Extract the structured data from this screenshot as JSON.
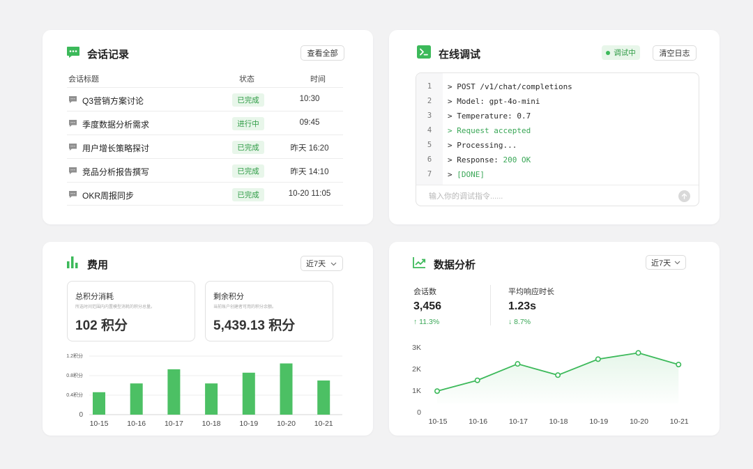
{
  "colors": {
    "accent": "#3cb95a",
    "accent_light": "#e8f6ea",
    "muted": "#999999"
  },
  "sessions": {
    "title": "会话记录",
    "icon": "chat-bubble-icon",
    "view_all": "查看全部",
    "headers": {
      "title": "会话标题",
      "status": "状态",
      "time": "时间"
    },
    "rows": [
      {
        "title": "Q3营销方案讨论",
        "status": "已完成",
        "time": "10:30"
      },
      {
        "title": "季度数据分析需求",
        "status": "进行中",
        "time": "09:45"
      },
      {
        "title": "用户增长策略探讨",
        "status": "已完成",
        "time": "昨天 16:20"
      },
      {
        "title": "竞品分析报告撰写",
        "status": "已完成",
        "time": "昨天 14:10"
      },
      {
        "title": "OKR周报同步",
        "status": "已完成",
        "time": "10-20 11:05"
      }
    ]
  },
  "debug": {
    "title": "在线调试",
    "icon": "terminal-icon",
    "status": "调试中",
    "clear": "清空日志",
    "lines": [
      {
        "num": "1",
        "text": "> POST /v1/chat/completions"
      },
      {
        "num": "2",
        "text": "> Model: gpt-4o-mini"
      },
      {
        "num": "3",
        "text": "> Temperature: 0.7"
      },
      {
        "num": "4",
        "text": "> Request accepted"
      },
      {
        "num": "5",
        "text": "> Processing..."
      },
      {
        "num": "6",
        "prefix": "> Response: ",
        "highlight": "200 OK"
      },
      {
        "num": "7",
        "prefix": "> ",
        "highlight": "[DONE]"
      }
    ],
    "input_placeholder": "输入你的调试指令......"
  },
  "cost": {
    "title": "费用",
    "icon": "bar-chart-icon",
    "range": "近7天",
    "total": {
      "label": "总积分消耗",
      "desc": "所选时间范围内内置模型消耗的积分总量。",
      "value": "102 积分"
    },
    "remaining": {
      "label": "剩余积分",
      "desc": "当前账户创建者可用的积分余额。",
      "value": "5,439.13 积分"
    }
  },
  "analytics": {
    "title": "数据分析",
    "icon": "trend-chart-icon",
    "range": "近7天",
    "sessions_label": "会话数",
    "sessions_value": "3,456",
    "sessions_change": "↑ 11.3%",
    "latency_label": "平均响应时长",
    "latency_value": "1.23s",
    "latency_change": "↓ 8.7%"
  },
  "chart_data": [
    {
      "type": "bar",
      "categories": [
        "10-15",
        "10-16",
        "10-17",
        "10-18",
        "10-19",
        "10-20",
        "10-21"
      ],
      "values": [
        0.46,
        0.64,
        0.93,
        0.64,
        0.86,
        1.05,
        0.7
      ],
      "yticks": [
        "0",
        "0.4积分",
        "0.8积分",
        "1.2积分"
      ],
      "ylim": [
        0,
        1.2
      ],
      "grid": true
    },
    {
      "type": "area",
      "categories": [
        "10-15",
        "10-16",
        "10-17",
        "10-18",
        "10-19",
        "10-20",
        "10-21"
      ],
      "values": [
        960,
        1460,
        2220,
        1700,
        2440,
        2730,
        2190
      ],
      "yticks": [
        "0",
        "1K",
        "2K",
        "3K"
      ],
      "ylim": [
        0,
        3000
      ],
      "grid": false
    }
  ]
}
